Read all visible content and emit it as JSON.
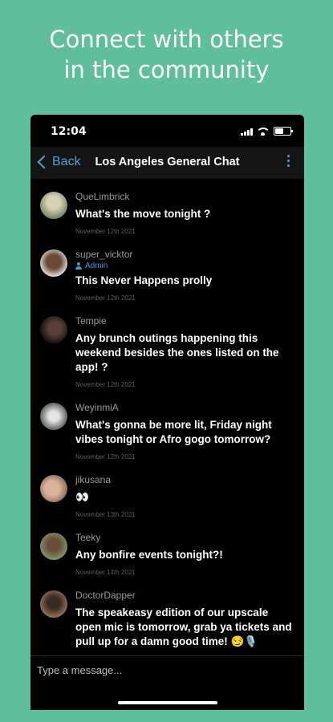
{
  "promo": {
    "headline_line1": "Connect with others",
    "headline_line2": "in the community"
  },
  "status_bar": {
    "time": "12:04"
  },
  "navbar": {
    "back_label": "Back",
    "title": "Los Angeles General Chat"
  },
  "messages": [
    {
      "user": "QueLimbrick",
      "text": "What's the move tonight ?",
      "date": "November 12th 2021",
      "avatar_color": "#a8a68c"
    },
    {
      "user": "super_vicktor",
      "badge": "Admin",
      "text": "This Never Happens prolly",
      "date": "November 12th 2021",
      "avatar_color": "#8a6a52"
    },
    {
      "user": "Tempie",
      "text": "Any brunch outings happening this weekend besides the ones listed on the app! ?",
      "date": "November 12th 2021",
      "avatar_color": "#2a2a2a"
    },
    {
      "user": "WeyinmiA",
      "text": "What's gonna be more lit, Friday night vibes tonight or Afro gogo tomorrow?",
      "date": "November 12th 2021",
      "avatar_color": "#9a9a9a"
    },
    {
      "user": "jikusana",
      "text": "👀",
      "date": "November 13th 2021",
      "avatar_color": "#c9a58c"
    },
    {
      "user": "Teeky",
      "text": "Any bonfire events tonight?!",
      "date": "November 14th 2021",
      "avatar_color": "#6a7a5a"
    },
    {
      "user": "DoctorDapper",
      "text": "The speakeasy edition of our upscale open mic is tomorrow, grab ya tickets and pull up for a damn good time! 😏🎙️",
      "date": "",
      "avatar_color": "#6b5540"
    }
  ],
  "composer": {
    "placeholder": "Type a message..."
  },
  "colors": {
    "background": "#5fbf9a",
    "accent": "#4ba4d9"
  }
}
